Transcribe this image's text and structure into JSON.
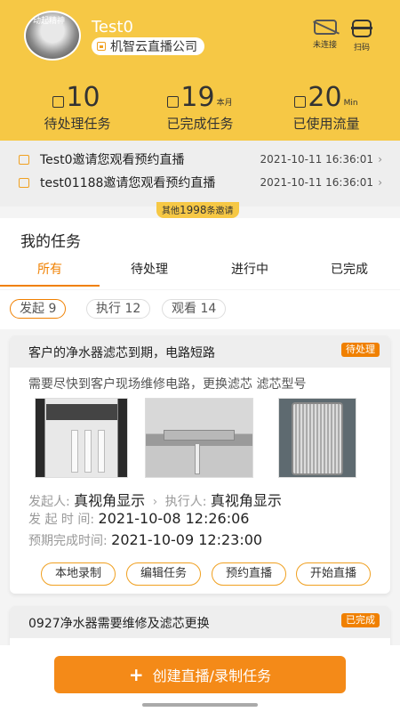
{
  "header": {
    "avatar_text": "动起精神",
    "username": "Test0",
    "company": "机智云直播公司",
    "connection_label": "未连接",
    "scan_label": "扫码"
  },
  "stats": [
    {
      "value": "10",
      "unit": "",
      "label": "待处理任务",
      "icon": "calendar-icon"
    },
    {
      "value": "19",
      "unit": "本月",
      "label": "已完成任务",
      "icon": "calendar-icon"
    },
    {
      "value": "20",
      "unit": "Min",
      "label": "已使用流量",
      "icon": "calendar-icon"
    }
  ],
  "invites": {
    "items": [
      {
        "text": "Test0邀请您观看预约直播",
        "time": "2021-10-11 16:36:01"
      },
      {
        "text": "test01188邀请您观看预约直播",
        "time": "2021-10-11 16:36:01"
      }
    ],
    "more_prefix": "其他",
    "more_count": "1998",
    "more_suffix": "条邀请"
  },
  "tasks": {
    "title": "我的任务",
    "tabs": [
      "所有",
      "待处理",
      "进行中",
      "已完成"
    ],
    "active_tab": 0,
    "filters": [
      {
        "label": "发起 9",
        "active": true
      },
      {
        "label": "执行 12",
        "active": false
      },
      {
        "label": "观看 14",
        "active": false
      }
    ]
  },
  "cards": [
    {
      "title": "客户的净水器滤芯到期，电路短路",
      "status": "待处理",
      "description": "需要尽快到客户现场维修电路，更换滤芯 滤芯型号",
      "initiator_label": "发起人:",
      "initiator": "真视角显示",
      "executor_label": "执行人:",
      "executor": "真视角显示",
      "start_label": "发 起 时 间:",
      "start_time": "2021-10-08 12:26:06",
      "due_label": "预期完成时间:",
      "due_time": "2021-10-09 12:23:00",
      "actions": [
        "本地录制",
        "编辑任务",
        "预约直播",
        "开始直播"
      ]
    },
    {
      "title": "0927净水器需要维修及滤芯更换",
      "status": "已完成"
    }
  ],
  "create_button": "创建直播/录制任务",
  "colors": {
    "header_bg": "#f6c845",
    "accent": "#f08000",
    "primary_button": "#f48a18"
  }
}
